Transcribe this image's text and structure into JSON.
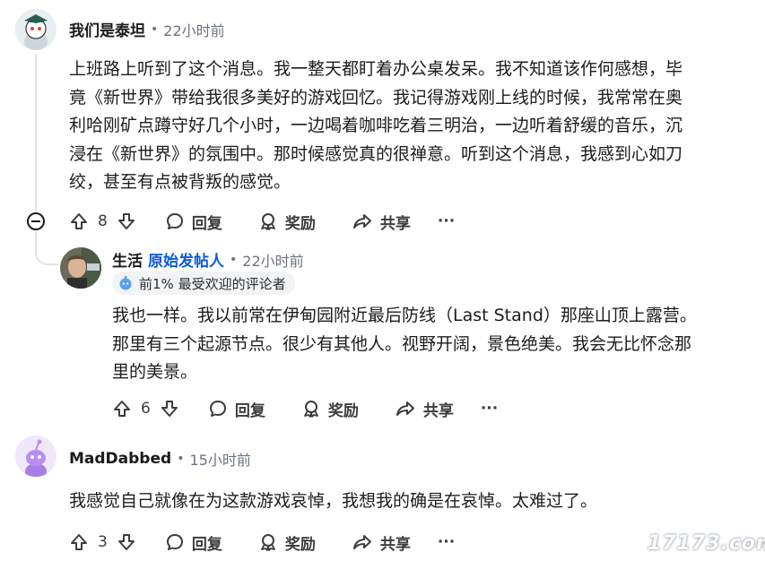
{
  "comments": [
    {
      "username": "我们是泰坦",
      "time": "22小时前",
      "body_lines": [
        "上班路上听到了这个消息。我一整天都盯着办公桌发呆。我不知道该作何感想，毕",
        "竟《新世界》带给我很多美好的游戏回忆。我记得游戏刚上线的时候，我常常在奥",
        "利哈刚矿点蹲守好几个小时，一边喝着咖啡吃着三明治，一边听着舒缓的音乐，沉",
        "浸在《新世界》的氛围中。那时候感觉真的很禅意。听到这个消息，我感到心如刀",
        "绞，甚至有点被背叛的感觉。"
      ],
      "votes": "8",
      "reply_label": "回复",
      "award_label": "奖励",
      "share_label": "共享",
      "more_label": "···"
    },
    {
      "username": "生活",
      "op_tag": "原始发帖人",
      "time": "22小时前",
      "badge": "前1% 最受欢迎的评论者",
      "body_lines": [
        "我也一样。我以前常在伊甸园附近最后防线（Last Stand）那座山顶上露营。",
        "那里有三个起源节点。很少有其他人。视野开阔，景色绝美。我会无比怀念那",
        "里的美景。"
      ],
      "votes": "6",
      "reply_label": "回复",
      "award_label": "奖励",
      "share_label": "共享",
      "more_label": "···"
    },
    {
      "username": "MadDabbed",
      "time": "15小时前",
      "body_lines": [
        "我感觉自己就像在为这款游戏哀悼，我想我的确是在哀悼。太难过了。"
      ],
      "votes": "3",
      "reply_label": "回复",
      "award_label": "奖励",
      "share_label": "共享",
      "more_label": "···"
    }
  ],
  "separator_dot": "•",
  "watermark": "17173.com",
  "colors": {
    "op_tag": "#0a5bd8",
    "thread_line": "#dfe3e6",
    "snoo_purple": "#b98ef0"
  }
}
